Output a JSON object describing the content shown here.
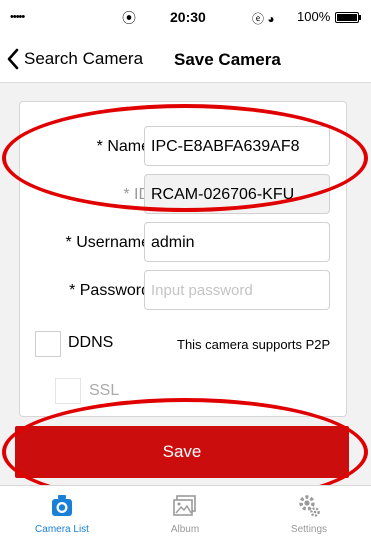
{
  "status_bar": {
    "signal": "•••••",
    "wifi": "⦿",
    "time": "20:30",
    "icons": "ⓔ ◕",
    "battery": "100%"
  },
  "nav": {
    "back_label": "Search Camera",
    "title": "Save Camera"
  },
  "form": {
    "name": {
      "label": "* Name",
      "value": "IPC-E8ABFA639AF8"
    },
    "id": {
      "label": "* ID",
      "value": "RCAM-026706-KFU"
    },
    "username": {
      "label": "* Username",
      "value": "admin"
    },
    "password": {
      "label": "* Password",
      "placeholder": "Input password"
    },
    "ddns": {
      "label": "DDNS",
      "checked": false
    },
    "p2p_note": "This camera supports P2P",
    "ssl": {
      "label": "SSL",
      "checked": false,
      "disabled": true
    }
  },
  "save_button": "Save",
  "tabs": [
    {
      "label": "Camera List",
      "icon": "camera-icon",
      "active": true
    },
    {
      "label": "Album",
      "icon": "album-icon",
      "active": false
    },
    {
      "label": "Settings",
      "icon": "settings-icon",
      "active": false
    }
  ],
  "colors": {
    "accent": "#1a7fd6",
    "save_button": "#cc0d0d",
    "annotation": "#e00000"
  }
}
